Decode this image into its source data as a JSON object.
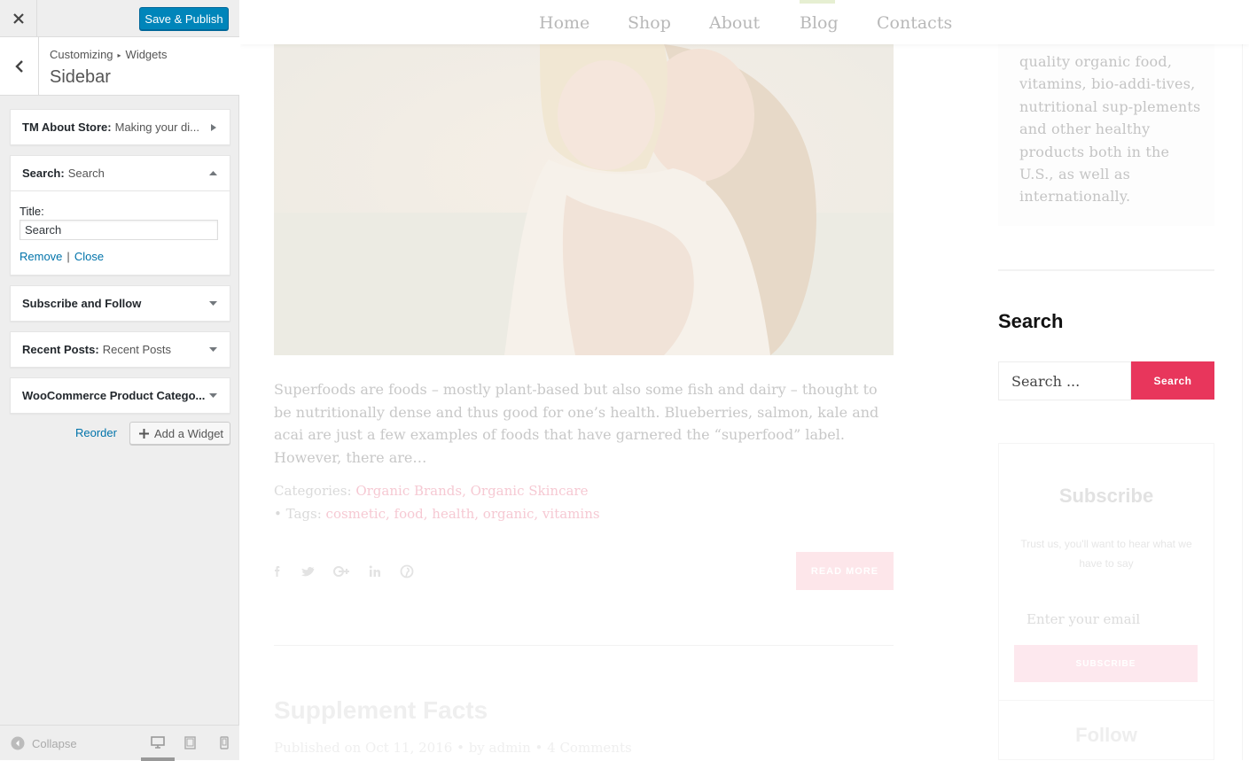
{
  "customizer": {
    "close_label": "×",
    "publish_label": "Save & Publish",
    "breadcrumb_root": "Customizing",
    "breadcrumb_sep": "▸",
    "breadcrumb_child": "Widgets",
    "section_title": "Sidebar",
    "widgets": [
      {
        "title": "TM About Store:",
        "subtitle": "Making your di...",
        "expanded": false
      },
      {
        "title": "Search:",
        "subtitle": "Search",
        "expanded": true
      },
      {
        "title": "Subscribe and Follow",
        "subtitle": "",
        "expanded": false
      },
      {
        "title": "Recent Posts:",
        "subtitle": "Recent Posts",
        "expanded": false
      },
      {
        "title": "WooCommerce Product Catego...",
        "subtitle": "",
        "expanded": false
      }
    ],
    "search_widget": {
      "title_label": "Title:",
      "title_value": "Search",
      "remove_label": "Remove",
      "pipe": "|",
      "close_label": "Close"
    },
    "reorder_label": "Reorder",
    "add_widget_label": "Add a Widget",
    "collapse_label": "Collapse",
    "accent_color": "#0085ba"
  },
  "preview": {
    "nav": [
      "Home",
      "Shop",
      "About",
      "Blog",
      "Contacts"
    ],
    "post_excerpt": "Superfoods are foods – mostly plant-based but also some fish and dairy – thought to be nutritionally dense and thus good for one’s health. Blueberries, salmon, kale and acai are just a few examples of foods that have garnered the “superfood” label. However, there are…",
    "categories_label": "Categories:",
    "categories": "Organic Brands, Organic Skincare",
    "tags_label": "• Tags:",
    "tags": "cosmetic, food, health, organic, vitamins",
    "read_more": "READ MORE",
    "post2_title": "Supplement Facts",
    "post2_meta": "Published on Oct 11, 2016 • by admin • 4 Comments",
    "about_text": "quality organic food, vitamins, bio-addi-tives, nutritional sup-plements and other healthy products both in the U.S., as well as internationally.",
    "search_heading": "Search",
    "search_placeholder": "Search ...",
    "search_button": "Search",
    "subscribe_heading": "Subscribe",
    "subscribe_text": "Trust us, you'll want to hear what we have to say",
    "subscribe_placeholder": "Enter your email",
    "subscribe_button": "SUBSCRIBE",
    "follow_heading": "Follow",
    "brand_color": "#e8365c"
  }
}
